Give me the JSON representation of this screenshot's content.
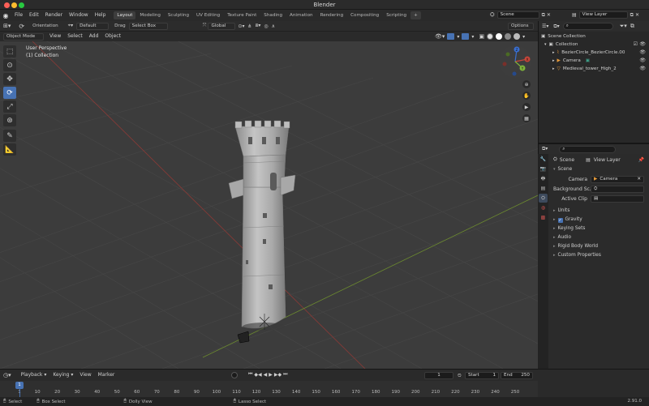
{
  "window": {
    "title": "Blender"
  },
  "menu": [
    "File",
    "Edit",
    "Render",
    "Window",
    "Help"
  ],
  "workspaces": [
    "Layout",
    "Modeling",
    "Sculpting",
    "UV Editing",
    "Texture Paint",
    "Shading",
    "Animation",
    "Rendering",
    "Compositing",
    "Scripting"
  ],
  "active_workspace": "Layout",
  "scene": {
    "name": "Scene",
    "view_layer": "View Layer"
  },
  "tool_settings": {
    "orientation_label": "Orientation",
    "orientation_value": "Default",
    "drag_label": "Drag",
    "drag_value": "Select Box",
    "transform_orientation": "Global",
    "options": "Options"
  },
  "viewport_header": {
    "mode": "Object Mode",
    "menus": [
      "View",
      "Select",
      "Add",
      "Object"
    ]
  },
  "viewport": {
    "perspective": "User Perspective",
    "collection": "(1) Collection"
  },
  "gizmo": {
    "x": "X",
    "y": "Y",
    "z": "Z"
  },
  "outliner": {
    "root": "Scene Collection",
    "collection": "Collection",
    "items": [
      {
        "name": "BezierCircle_BezierCircle.00",
        "icon": "curve-icon"
      },
      {
        "name": "Camera",
        "icon": "camera-icon"
      },
      {
        "name": "Medieval_tower_High_2",
        "icon": "mesh-icon"
      }
    ]
  },
  "properties": {
    "breadcrumb_scene": "Scene",
    "breadcrumb_layer": "View Layer",
    "section": "Scene",
    "camera_label": "Camera",
    "camera_value": "Camera",
    "background_label": "Background Sc...",
    "active_clip_label": "Active Clip",
    "panels": [
      "Units",
      "Gravity",
      "Keying Sets",
      "Audio",
      "Rigid Body World",
      "Custom Properties"
    ],
    "gravity_checked": true
  },
  "timeline": {
    "menus": [
      "Playback",
      "Keying",
      "View",
      "Marker"
    ],
    "current_frame": "1",
    "start_label": "Start",
    "start": "1",
    "end_label": "End",
    "end": "250",
    "ticks": [
      "1",
      "10",
      "20",
      "30",
      "40",
      "50",
      "60",
      "70",
      "80",
      "90",
      "100",
      "110",
      "120",
      "130",
      "140",
      "150",
      "160",
      "170",
      "180",
      "190",
      "200",
      "210",
      "220",
      "230",
      "240",
      "250"
    ]
  },
  "statusbar": {
    "select": "Select",
    "box_select": "Box Select",
    "dolly_view": "Dolly View",
    "lasso_select": "Lasso Select",
    "version": "2.91.0"
  },
  "colors": {
    "accent": "#4772b3",
    "active_frame": "#4772b3",
    "axis_x": "#c8463a",
    "axis_y": "#7fb53a",
    "axis_z": "#3a6fd1"
  }
}
